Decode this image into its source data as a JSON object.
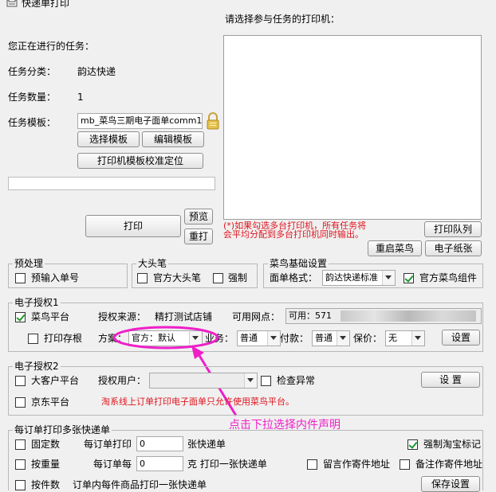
{
  "window": {
    "title": "快递单打印"
  },
  "task": {
    "current_label": "您正在进行的任务：",
    "category_label": "任务分类：",
    "category_value": "韵达快递",
    "count_label": "任务数量：",
    "count_value": "1",
    "template_label": "任务模板：",
    "template_value": "mb_菜鸟三期电子面单comm1",
    "select_template_btn": "选择模板",
    "edit_template_btn": "编辑模板",
    "calibrate_btn": "打印机模板校准定位",
    "progress": 0
  },
  "printers": {
    "label": "请选择参与任务的打印机：",
    "note": "(*)如果勾选多台打印机，所有任务将会平均分配到多台打印机同时输出。",
    "queue_btn": "打印队列",
    "restart_btn": "重启菜鸟",
    "paper_btn": "电子纸张"
  },
  "actions": {
    "print": "打印",
    "preview": "预览",
    "reprint": "重打"
  },
  "preprocess": {
    "title": "预处理",
    "input_number": "预输入单号",
    "input_number_checked": false
  },
  "bigpen": {
    "title": "大头笔",
    "official": "官方大头笔",
    "official_checked": false,
    "force": "强制",
    "force_checked": false
  },
  "cainiao": {
    "title": "菜鸟基础设置",
    "format_label": "面单格式：",
    "format_value": "韵达快递标准",
    "component": "官方菜鸟组件",
    "component_checked": true
  },
  "auth1": {
    "title": "电子授权1",
    "platform": "菜鸟平台",
    "platform_checked": true,
    "source_label": "授权来源：",
    "source_value": "精打测试店铺",
    "outlet_label": "可用网点：",
    "outlet_value": "可用：571",
    "print_stub": "打印存根",
    "print_stub_checked": false,
    "plan_label": "方案：",
    "plan_value": "官方：默认",
    "biz_label": "业务：",
    "biz_value": "普通",
    "pay_label": "付款：",
    "pay_value": "普通",
    "insure_label": "保价：",
    "insure_value": "无",
    "settings_btn": "设置"
  },
  "auth2": {
    "title": "电子授权2",
    "jd_big": "大客户平台",
    "jd_big_checked": false,
    "user_label": "授权用户：",
    "user_value": "",
    "check_abnormal": "检查异常",
    "check_abnormal_checked": false,
    "settings_btn": "设 置",
    "jd": "京东平台",
    "jd_checked": false,
    "warning": "淘系线上订单打印电子面单只允许使用菜鸟平台。"
  },
  "annotation": {
    "text": "点击下拉选择内件声明"
  },
  "multi": {
    "title": "每订单打印多张快递单",
    "fixed": "固定数",
    "fixed_checked": false,
    "per_order_label": "每订单打印",
    "per_order_value": "0",
    "per_order_unit": "张快递单",
    "force_tb": "强制淘宝标记",
    "force_tb_checked": true,
    "by_weight": "按重量",
    "by_weight_checked": false,
    "per_unit_label": "每订单每",
    "per_unit_value": "0",
    "per_unit_unit": "克 打印一张快递单",
    "sender_addr": "留言作寄件地址",
    "sender_addr_checked": false,
    "note_addr": "备注作寄件地址",
    "note_addr_checked": false,
    "by_item": "按件数",
    "by_item_checked": false,
    "by_item_text": "订单内每件商品打印一张快递单",
    "save_btn": "保存设置"
  },
  "colors": {
    "accent_red": "#e0141e",
    "annotation_magenta": "#ee1fc8",
    "check_green": "#1d9a2f"
  }
}
